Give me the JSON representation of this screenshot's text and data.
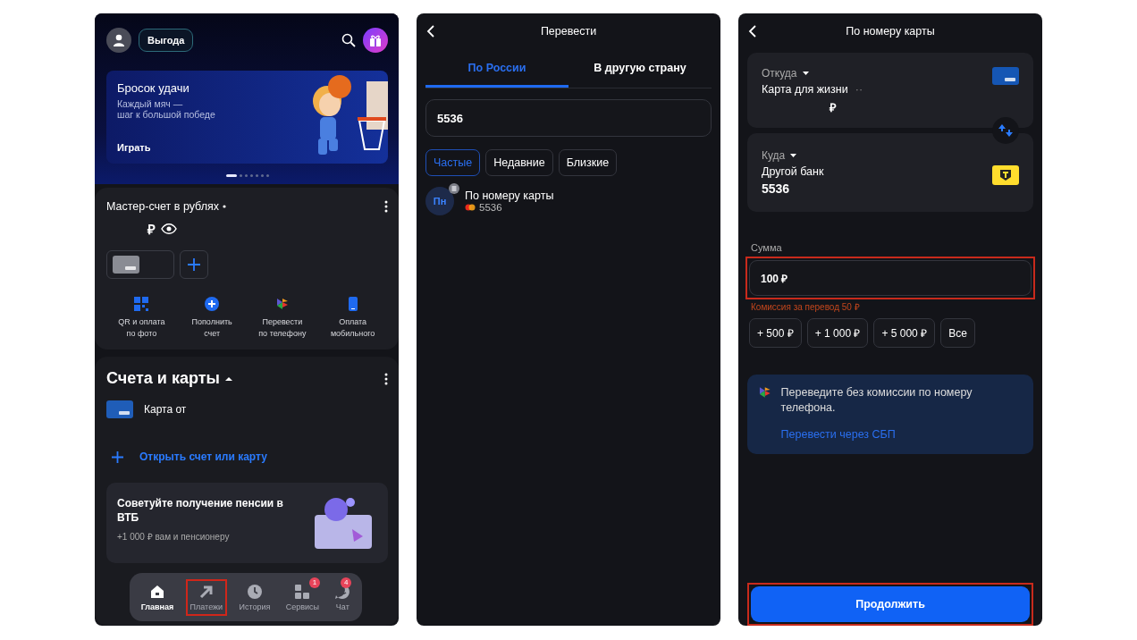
{
  "home_screen": {
    "top_bar": {
      "button": "Выгода"
    },
    "banner": {
      "title": "Бросок удачи",
      "subtitle": "Каждый мяч —\nшаг к большой победе",
      "action": "Играть"
    },
    "pager": [
      {
        "selected": true
      },
      {
        "selected": false
      },
      {
        "selected": false
      },
      {
        "selected": false
      },
      {
        "selected": false
      },
      {
        "selected": false
      },
      {
        "selected": false
      }
    ],
    "account": {
      "title": "Мастер-счет в рублях",
      "balance": "₽"
    },
    "quick_actions": [
      {
        "kind": "qr",
        "label": "QR и оплата\nпо фото"
      },
      {
        "kind": "topup",
        "label": "Пополнить\nсчет"
      },
      {
        "kind": "sbp",
        "label": "Перевести\nпо телефону"
      },
      {
        "kind": "mobile",
        "label": "Оплата\nмобильного"
      }
    ],
    "accounts_section": {
      "title": "Счета и карты",
      "cards": [
        {
          "name": "Карта от"
        }
      ],
      "open_link": "Открыть счет или карту"
    },
    "promo": {
      "title": "Советуйте получение пенсии в ВТБ",
      "text": "+1 000 ₽ вам и пенсионеру"
    },
    "nav": [
      {
        "kind": "home",
        "label": "Главная",
        "selected": true,
        "highlighted": false
      },
      {
        "kind": "payments",
        "label": "Платежи",
        "selected": false,
        "highlighted": true
      },
      {
        "kind": "history",
        "label": "История",
        "selected": false,
        "highlighted": false
      },
      {
        "kind": "services",
        "label": "Сервисы",
        "selected": false,
        "highlighted": false,
        "badge": "1"
      },
      {
        "kind": "chat",
        "label": "Чат",
        "selected": false,
        "highlighted": false,
        "badge": "4"
      }
    ]
  },
  "transfer_screen": {
    "title": "Перевести",
    "tabs": [
      {
        "label": "По России",
        "selected": true
      },
      {
        "label": "В другую страну",
        "selected": false
      }
    ],
    "search": {
      "value": "5536"
    },
    "chips": [
      {
        "label": "Частые",
        "selected": true
      },
      {
        "label": "Недавние",
        "selected": false
      },
      {
        "label": "Близкие",
        "selected": false
      }
    ],
    "contacts": [
      {
        "initials": "Пн",
        "name": "По номеру карты",
        "number": "5536"
      }
    ]
  },
  "card_transfer_screen": {
    "title": "По номеру карты",
    "from": {
      "label": "Откуда",
      "name": "Карта для жизни",
      "extra": "··",
      "balance": "₽"
    },
    "to": {
      "label": "Куда",
      "name": "Другой банк",
      "number": "5536"
    },
    "amount": {
      "label": "Сумма",
      "value": "100 ₽",
      "highlighted": true
    },
    "commission": "Комиссия за перевод 50 ₽",
    "quick_amounts": [
      "+ 500 ₽",
      "+ 1 000 ₽",
      "+ 5 000 ₽",
      "Все"
    ],
    "info": {
      "text": "Переведите без комиссии по номеру телефона.",
      "link": "Перевести через СБП"
    },
    "continue": {
      "label": "Продолжить",
      "highlighted": true
    }
  }
}
